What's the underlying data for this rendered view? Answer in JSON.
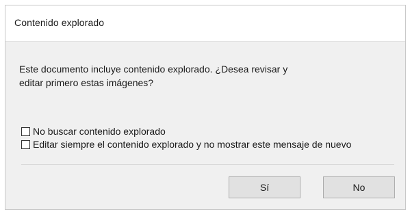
{
  "dialog": {
    "title": "Contenido explorado",
    "message_line1": "Este documento incluye contenido explorado. ¿Desea revisar y",
    "message_line2": "editar primero estas imágenes?",
    "options": [
      {
        "label": "No buscar contenido explorado",
        "checked": false
      },
      {
        "label": "Editar siempre el contenido explorado y no mostrar este mensaje de nuevo",
        "checked": false
      }
    ],
    "buttons": {
      "yes_label": "Sí",
      "no_label": "No"
    }
  }
}
